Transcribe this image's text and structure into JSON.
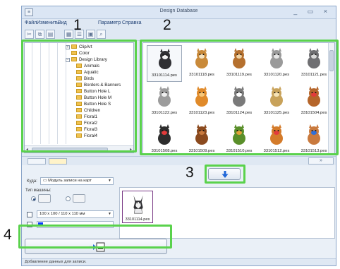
{
  "window": {
    "title": "Design Database",
    "controls": "_ ▭ ×"
  },
  "menu": [
    "Файл",
    "Изменить",
    "Вид",
    "Параметр",
    "Справка"
  ],
  "callouts": [
    "1",
    "2",
    "3",
    "4"
  ],
  "tree": [
    {
      "label": "ClipArt",
      "expander": "+"
    },
    {
      "label": "Color",
      "expander": ""
    },
    {
      "label": "Design Library",
      "expander": "−"
    },
    {
      "label": "Animals"
    },
    {
      "label": "Aquatic"
    },
    {
      "label": "Birds"
    },
    {
      "label": "Borders & Banners"
    },
    {
      "label": "Button Hole L"
    },
    {
      "label": "Button Hole M"
    },
    {
      "label": "Button Hole S"
    },
    {
      "label": "Children"
    },
    {
      "label": "Floral1"
    },
    {
      "label": "Floral2"
    },
    {
      "label": "Floral3"
    },
    {
      "label": "Floral4"
    }
  ],
  "designs": [
    {
      "file": "33101114.pes",
      "icon": "husky-dog-icon"
    },
    {
      "file": "33101118.pes",
      "icon": "beagle-dog-icon"
    },
    {
      "file": "33101119.pes",
      "icon": "spaniel-dog-icon"
    },
    {
      "file": "33101120.pes",
      "icon": "terrier-dog-icon"
    },
    {
      "file": "33101121.pes",
      "icon": "schnauzer-dog-icon"
    },
    {
      "file": "33101122.pes",
      "icon": "persian-cat-icon"
    },
    {
      "file": "33101123.pes",
      "icon": "orange-cat-icon"
    },
    {
      "file": "33101124.pes",
      "icon": "kitten-icon"
    },
    {
      "file": "33101125.pes",
      "icon": "cat-with-ball-icon"
    },
    {
      "file": "33101504.pes",
      "icon": "bear-with-hearts-icon"
    },
    {
      "file": "33101508.pes",
      "icon": "dancing-animal-icon"
    },
    {
      "file": "33101509.pes",
      "icon": "teddy-bear-icon"
    },
    {
      "file": "33101510.pes",
      "icon": "animal-with-net-icon"
    },
    {
      "file": "33101512.pes",
      "icon": "bear-with-balloon-icon"
    },
    {
      "file": "33101513.pes",
      "icon": "bear-with-ball-icon"
    }
  ],
  "where_label": "Куда:",
  "where_value": "Модуль записи на карт",
  "machine_type_label": "Тип машины:",
  "hoop_value": "100 x 100 / 110 x 110 мм",
  "queue": [
    {
      "file": "33101114.pes",
      "icon": "husky-dog-icon"
    }
  ],
  "status_text": "Добавление данных для записи.",
  "colors": {
    "highlight": "#5ad24c",
    "accent_blue": "#1f66d8",
    "swatch_blue": "#0a3cff",
    "selected_border": "#7a3a86"
  }
}
